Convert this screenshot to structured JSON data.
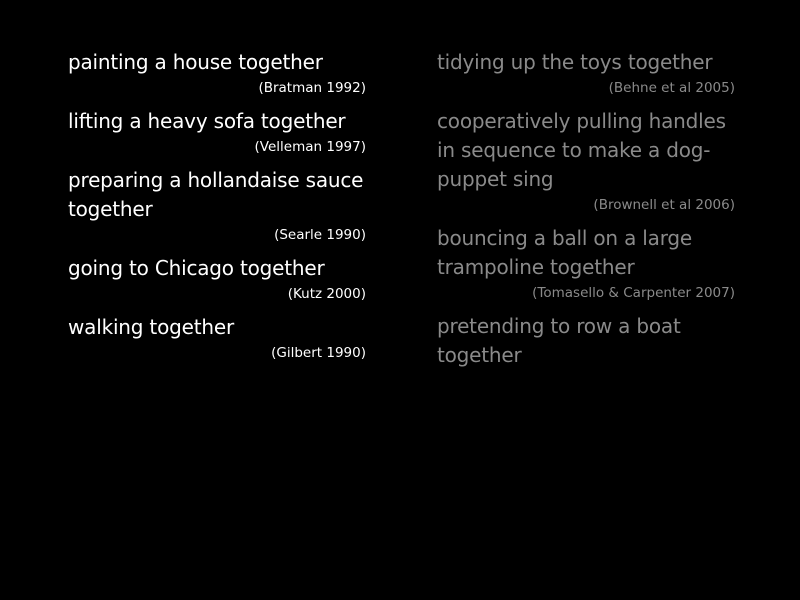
{
  "left_column": [
    {
      "activity": "painting a house together",
      "citation": "(Bratman 1992)"
    },
    {
      "activity": "lifting a heavy sofa together",
      "citation": "(Velleman 1997)"
    },
    {
      "activity": "preparing a hollandaise sauce together",
      "citation": "(Searle 1990)"
    },
    {
      "activity": "going to Chicago together",
      "citation": "(Kutz 2000)"
    },
    {
      "activity": "walking together",
      "citation": "(Gilbert 1990)"
    }
  ],
  "right_column": [
    {
      "activity": "tidying up the toys together",
      "citation": "(Behne et al 2005)"
    },
    {
      "activity": "cooperatively pulling handles in sequence to make a dog-puppet sing",
      "citation": "(Brownell et al 2006)"
    },
    {
      "activity": "bouncing a ball on a large trampoline together",
      "citation": "(Tomasello & Carpenter 2007)"
    },
    {
      "activity": "pretending to row a boat together",
      "citation": ""
    }
  ],
  "colors": {
    "background": "#000000",
    "left_text": "#ffffff",
    "right_text": "#8a8a8a"
  }
}
